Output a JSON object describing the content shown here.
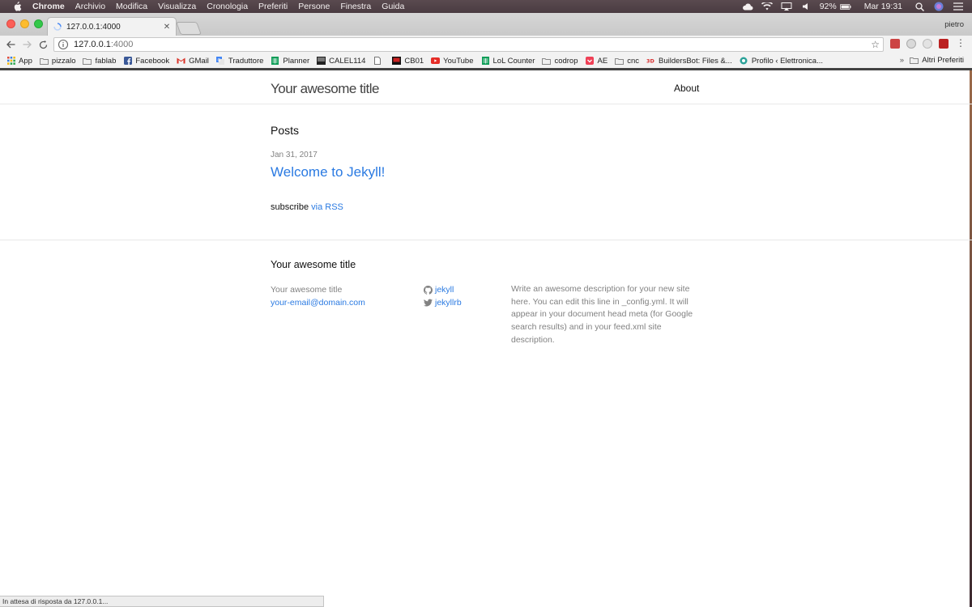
{
  "menubar": {
    "app": "Chrome",
    "items": [
      "Archivio",
      "Modifica",
      "Visualizza",
      "Cronologia",
      "Preferiti",
      "Persone",
      "Finestra",
      "Guida"
    ],
    "battery": "92%",
    "clock": "Mar 19:31"
  },
  "browser": {
    "tab_title": "127.0.0.1:4000",
    "profile": "pietro",
    "url_host": "127.0.0.1",
    "url_port": ":4000",
    "status": "In attesa di risposta da 127.0.0.1..."
  },
  "bookmarks": {
    "items": [
      {
        "label": "App",
        "icon": "apps-grid-icon"
      },
      {
        "label": "pizzalo",
        "icon": "folder-icon"
      },
      {
        "label": "fablab",
        "icon": "folder-icon"
      },
      {
        "label": "Facebook",
        "icon": "facebook-icon"
      },
      {
        "label": "GMail",
        "icon": "gmail-icon"
      },
      {
        "label": "Traduttore",
        "icon": "translate-icon"
      },
      {
        "label": "Planner",
        "icon": "sheet-icon"
      },
      {
        "label": "CALEL114",
        "icon": "site-icon"
      },
      {
        "label": "",
        "icon": "page-icon"
      },
      {
        "label": "CB01",
        "icon": "site-icon"
      },
      {
        "label": "YouTube",
        "icon": "youtube-icon"
      },
      {
        "label": "LoL Counter",
        "icon": "sheet-icon"
      },
      {
        "label": "codrop",
        "icon": "folder-icon"
      },
      {
        "label": "AE",
        "icon": "pocket-icon"
      },
      {
        "label": "cnc",
        "icon": "folder-icon"
      },
      {
        "label": "BuildersBot: Files &...",
        "icon": "site-icon"
      },
      {
        "label": "Profilo ‹ Elettronica...",
        "icon": "site-icon"
      }
    ],
    "more": "»",
    "other": "Altri Preferiti"
  },
  "site": {
    "title": "Your awesome title",
    "nav_about": "About",
    "posts_heading": "Posts",
    "post_date": "Jan 31, 2017",
    "post_title": "Welcome to Jekyll!",
    "subscribe_text": "subscribe ",
    "subscribe_link": "via RSS"
  },
  "footer": {
    "heading": "Your awesome title",
    "name": "Your awesome title",
    "email": "your-email@domain.com",
    "github": "jekyll",
    "twitter": "jekyllrb",
    "description": "Write an awesome description for your new site here. You can edit this line in _config.yml. It will appear in your document head meta (for Google search results) and in your feed.xml site description."
  },
  "colors": {
    "link": "#2a7ae2",
    "muted": "#828282",
    "text": "#111111"
  }
}
